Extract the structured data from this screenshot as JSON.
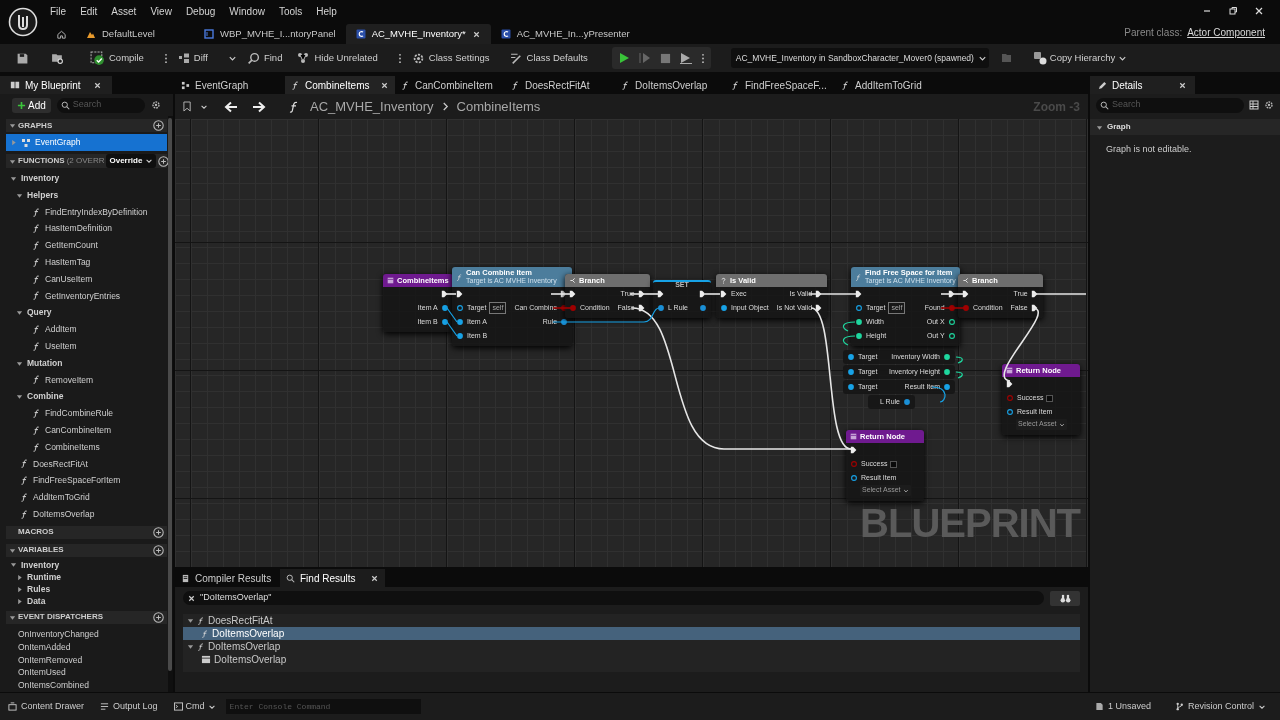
{
  "app_menu": [
    "File",
    "Edit",
    "Asset",
    "View",
    "Debug",
    "Window",
    "Tools",
    "Help"
  ],
  "document_tabs": [
    {
      "kind": "level",
      "label": "DefaultLevel",
      "selected": false
    },
    {
      "kind": "widget",
      "label": "WBP_MVHE_I...ntoryPanel",
      "selected": false
    },
    {
      "kind": "blueprint",
      "label": "AC_MVHE_Inventory*",
      "selected": true
    },
    {
      "kind": "blueprint",
      "label": "AC_MVHE_In...yPresenter",
      "selected": false
    }
  ],
  "parent_class": {
    "label": "Parent class:",
    "value": "Actor Component"
  },
  "toolbar": {
    "items": [
      {
        "kind": "save"
      },
      {
        "kind": "browse"
      },
      {
        "kind": "compile",
        "label": "Compile"
      },
      {
        "kind": "diff",
        "label": "Diff"
      },
      {
        "kind": "find",
        "label": "Find"
      },
      {
        "kind": "hide",
        "label": "Hide Unrelated"
      },
      {
        "kind": "settings",
        "label": "Class Settings"
      },
      {
        "kind": "defaults",
        "label": "Class Defaults"
      }
    ],
    "debug_object": "AC_MVHE_Inventory in SandboxCharacter_Mover0 (spawned)",
    "copy_hierarchy": "Copy Hierarchy"
  },
  "my_blueprint": {
    "title": "My Blueprint",
    "add_label": "Add",
    "search_placeholder": "Search",
    "sections": [
      {
        "title": "GRAPHS",
        "expanded": true,
        "items": [
          {
            "kind": "graph",
            "label": "EventGraph",
            "selected": true
          }
        ]
      },
      {
        "title": "FUNCTIONS",
        "note": "(2 OVERR",
        "override": "Override",
        "expanded": true,
        "items": [
          {
            "kind": "category",
            "label": "Inventory",
            "expanded": true,
            "selected": false,
            "children": [
              {
                "kind": "category",
                "label": "Helpers",
                "expanded": true,
                "selected": false,
                "children": [
                  {
                    "kind": "function",
                    "label": "FindEntryIndexByDefinition",
                    "selected": false
                  },
                  {
                    "kind": "function",
                    "label": "HasItemDefinition",
                    "selected": false
                  },
                  {
                    "kind": "function",
                    "label": "GetItemCount",
                    "selected": false
                  },
                  {
                    "kind": "function",
                    "label": "HasItemTag",
                    "selected": false
                  },
                  {
                    "kind": "function",
                    "label": "CanUseItem",
                    "selected": false
                  },
                  {
                    "kind": "function",
                    "label": "GetInventoryEntries",
                    "selected": false
                  }
                ]
              },
              {
                "kind": "category",
                "label": "Query",
                "expanded": true,
                "selected": false,
                "children": [
                  {
                    "kind": "function",
                    "label": "AddItem",
                    "selected": false
                  },
                  {
                    "kind": "function",
                    "label": "UseItem",
                    "selected": false
                  }
                ]
              },
              {
                "kind": "category",
                "label": "Mutation",
                "expanded": true,
                "selected": false,
                "children": [
                  {
                    "kind": "function",
                    "label": "RemoveItem",
                    "selected": false
                  }
                ]
              },
              {
                "kind": "category",
                "label": "Combine",
                "expanded": true,
                "selected": false,
                "children": [
                  {
                    "kind": "function",
                    "label": "FindCombineRule",
                    "selected": false
                  },
                  {
                    "kind": "function",
                    "label": "CanCombineItem",
                    "selected": false
                  },
                  {
                    "kind": "function",
                    "label": "CombineItems",
                    "selected": false
                  }
                ]
              }
            ]
          },
          {
            "kind": "function",
            "label": "DoesRectFitAt",
            "selected": false
          },
          {
            "kind": "function",
            "label": "FindFreeSpaceForItem",
            "selected": false
          },
          {
            "kind": "function",
            "label": "AddItemToGrid",
            "selected": false
          },
          {
            "kind": "function",
            "label": "DoItemsOverlap",
            "selected": false
          }
        ]
      },
      {
        "title": "MACROS"
      },
      {
        "title": "VARIABLES",
        "expanded": true,
        "items": [
          {
            "kind": "category",
            "label": "Inventory",
            "expanded": true,
            "selected": false,
            "children": [
              {
                "kind": "category",
                "label": "Runtime",
                "expanded": false,
                "selected": false
              },
              {
                "kind": "category",
                "label": "Rules",
                "expanded": false,
                "selected": false
              },
              {
                "kind": "category",
                "label": "Data",
                "expanded": false,
                "selected": false
              }
            ]
          }
        ]
      },
      {
        "title": "EVENT DISPATCHERS",
        "expanded": true,
        "items": [
          {
            "kind": "dispatcher",
            "label": "OnInventoryChanged",
            "selected": false
          },
          {
            "kind": "dispatcher",
            "label": "OnItemAdded",
            "selected": false
          },
          {
            "kind": "dispatcher",
            "label": "OnItemRemoved",
            "selected": false
          },
          {
            "kind": "dispatcher",
            "label": "OnItemUsed",
            "selected": false
          },
          {
            "kind": "dispatcher",
            "label": "OnItemsCombined",
            "selected": false
          }
        ]
      }
    ]
  },
  "graph_tabs": [
    {
      "kind": "event",
      "label": "EventGraph",
      "selected": false
    },
    {
      "kind": "function",
      "label": "CombineItems",
      "selected": true
    },
    {
      "kind": "function",
      "label": "CanCombineItem",
      "selected": false
    },
    {
      "kind": "function",
      "label": "DoesRectFitAt",
      "selected": false
    },
    {
      "kind": "function",
      "label": "DoItemsOverlap",
      "selected": false
    },
    {
      "kind": "function",
      "label": "FindFreeSpaceF...",
      "selected": false
    },
    {
      "kind": "function",
      "label": "AddItemToGrid",
      "selected": false
    }
  ],
  "breadcrumb": {
    "owner": "AC_MVHE_Inventory",
    "graph": "CombineItems"
  },
  "zoom": "Zoom -3",
  "watermark": "BLUEPRINT",
  "nodes": [
    {
      "kind": "entry",
      "title": "CombineItems",
      "outputs": [
        {
          "kind": "exec",
          "linked": true
        },
        {
          "kind": "object",
          "label": "Item A",
          "linked": true
        },
        {
          "kind": "object",
          "label": "Item B",
          "linked": true
        }
      ]
    },
    {
      "kind": "call",
      "title": "Can Combine Item",
      "subtitle": "Target is AC MVHE Inventory",
      "inputs": [
        {
          "kind": "exec",
          "linked": true
        },
        {
          "kind": "object",
          "label": "Target",
          "linked": false,
          "value": "self"
        },
        {
          "kind": "object",
          "label": "Item A",
          "linked": true
        },
        {
          "kind": "object",
          "label": "Item B",
          "linked": true
        }
      ],
      "outputs": [
        {
          "kind": "exec",
          "linked": true
        },
        {
          "kind": "bool",
          "label": "Can Combine",
          "linked": true
        },
        {
          "kind": "struct",
          "label": "Rule",
          "linked": true
        }
      ]
    },
    {
      "kind": "branch",
      "title": "Branch",
      "inputs": [
        {
          "kind": "exec",
          "linked": true
        },
        {
          "kind": "bool",
          "label": "Condition",
          "linked": true
        }
      ],
      "outputs": [
        {
          "kind": "exec",
          "label": "True",
          "linked": true
        },
        {
          "kind": "exec",
          "label": "False",
          "linked": true
        }
      ]
    },
    {
      "kind": "set",
      "title": "SET",
      "inputs": [
        {
          "kind": "exec",
          "linked": true
        },
        {
          "kind": "struct",
          "label": "L Rule",
          "linked": true
        }
      ],
      "outputs": [
        {
          "kind": "exec",
          "linked": true
        },
        {
          "kind": "struct",
          "linked": true
        }
      ]
    },
    {
      "kind": "is_valid",
      "title": "Is Valid",
      "inputs": [
        {
          "kind": "exec",
          "label": "Exec",
          "linked": true
        },
        {
          "kind": "object",
          "label": "Input Object",
          "linked": true
        }
      ],
      "outputs": [
        {
          "kind": "exec",
          "label": "Is Valid",
          "linked": true
        },
        {
          "kind": "exec",
          "label": "Is Not Valid",
          "linked": true
        }
      ]
    },
    {
      "kind": "call",
      "title": "Find Free Space for Item",
      "subtitle": "Target is AC MVHE Inventory",
      "inputs": [
        {
          "kind": "exec",
          "linked": true
        },
        {
          "kind": "object",
          "label": "Target",
          "linked": false,
          "value": "self"
        },
        {
          "kind": "int",
          "label": "Width",
          "linked": true
        },
        {
          "kind": "int",
          "label": "Height",
          "linked": true
        }
      ],
      "outputs": [
        {
          "kind": "exec",
          "linked": true
        },
        {
          "kind": "bool",
          "label": "Found",
          "linked": true
        },
        {
          "kind": "int",
          "label": "Out X",
          "linked": false
        },
        {
          "kind": "int",
          "label": "Out Y",
          "linked": false
        }
      ]
    },
    {
      "kind": "branch",
      "title": "Branch",
      "inputs": [
        {
          "kind": "exec",
          "linked": true
        },
        {
          "kind": "bool",
          "label": "Condition",
          "linked": true
        }
      ],
      "outputs": [
        {
          "kind": "exec",
          "label": "True",
          "linked": true
        },
        {
          "kind": "exec",
          "label": "False",
          "linked": true
        }
      ]
    },
    {
      "kind": "getter",
      "inputs": [
        {
          "kind": "object",
          "label": "Target",
          "linked": true
        }
      ],
      "outputs": [
        {
          "kind": "int",
          "label": "Inventory Width",
          "linked": true
        }
      ]
    },
    {
      "kind": "getter",
      "inputs": [
        {
          "kind": "object",
          "label": "Target",
          "linked": true
        }
      ],
      "outputs": [
        {
          "kind": "int",
          "label": "Inventory Height",
          "linked": true
        }
      ]
    },
    {
      "kind": "getter",
      "inputs": [
        {
          "kind": "object",
          "label": "Target",
          "linked": true
        }
      ],
      "outputs": [
        {
          "kind": "object",
          "label": "Result Item",
          "linked": true
        }
      ]
    },
    {
      "kind": "getter",
      "outputs": [
        {
          "kind": "struct",
          "label": "L Rule",
          "linked": true
        }
      ]
    },
    {
      "kind": "return",
      "title": "Return Node",
      "inputs": [
        {
          "kind": "exec",
          "linked": true
        },
        {
          "kind": "bool",
          "label": "Success",
          "linked": false,
          "checked": false
        },
        {
          "kind": "object",
          "label": "Result Item",
          "linked": false,
          "dropdown": "Select Asset"
        }
      ]
    },
    {
      "kind": "return",
      "title": "Return Node",
      "inputs": [
        {
          "kind": "exec",
          "linked": true
        },
        {
          "kind": "bool",
          "label": "Success",
          "linked": false,
          "checked": false
        },
        {
          "kind": "object",
          "label": "Result Item",
          "linked": false,
          "dropdown": "Select Asset"
        }
      ]
    }
  ],
  "details": {
    "title": "Details",
    "search_placeholder": "Search",
    "section": "Graph",
    "message": "Graph is not editable."
  },
  "bottom_panel": {
    "tabs": [
      {
        "kind": "compiler",
        "label": "Compiler Results",
        "selected": false
      },
      {
        "kind": "find",
        "label": "Find Results",
        "selected": true
      }
    ],
    "query": "\"DoItemsOverlap\"",
    "results": [
      {
        "kind": "function",
        "label": "DoesRectFitAt",
        "expanded": true,
        "selected": false,
        "children": [
          {
            "kind": "function",
            "label": "DoItemsOverlap",
            "selected": true
          }
        ]
      },
      {
        "kind": "function",
        "label": "DoItemsOverlap",
        "expanded": true,
        "selected": false,
        "children": [
          {
            "kind": "entry",
            "label": "DoItemsOverlap",
            "selected": false
          }
        ]
      }
    ]
  },
  "status_bar": {
    "content_drawer": "Content Drawer",
    "output_log": "Output Log",
    "cmd": "Cmd",
    "console_placeholder": "Enter Console Command",
    "unsaved": "1 Unsaved",
    "revision_control": "Revision Control"
  }
}
